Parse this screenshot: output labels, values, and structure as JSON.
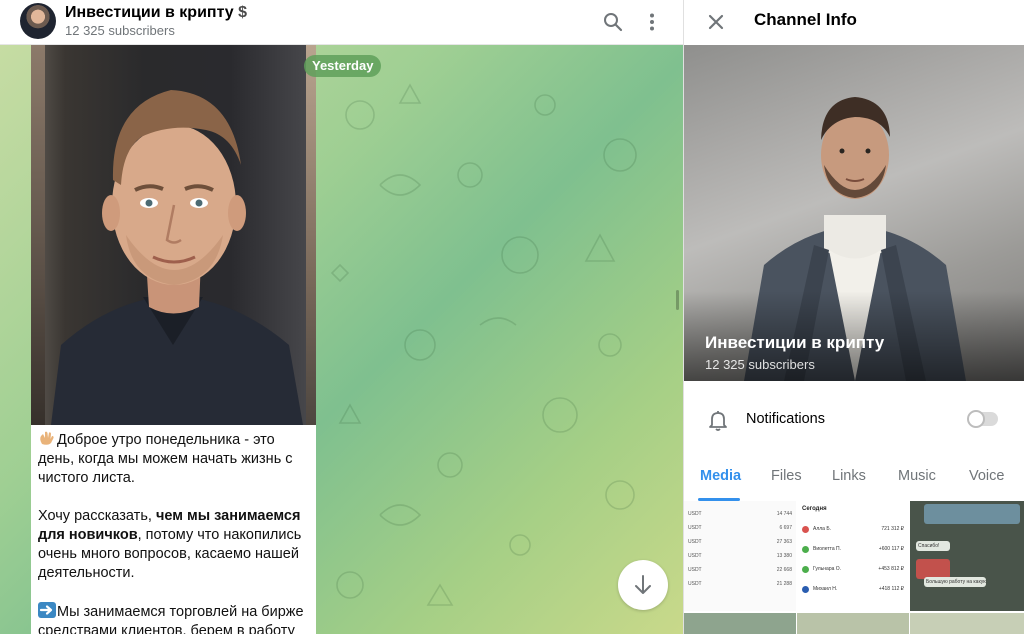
{
  "chat": {
    "title": "Инвестиции в крипту",
    "title_suffix": "$",
    "subtitle": "12 325 subscribers",
    "date_label": "Yesterday",
    "message": {
      "p1_emoji": "waving-hand",
      "p1": "Доброе утро понедельника - это день, когда мы можем начать жизнь с чистого листа.",
      "p2_start": "Хочу рассказать, ",
      "p2_bold": "чем мы занимаемся для новичков",
      "p2_end": ", потому что накопились очень много вопросов, касаемо нашей деятельности.",
      "p3_emoji": "right-arrow",
      "p3": "Мы занимаемся торговлей на бирже средствами клиентов, берем в работу"
    },
    "icons": {
      "search": "search-icon",
      "more": "more-vertical-icon",
      "scroll_down": "arrow-down-icon"
    }
  },
  "info": {
    "title": "Channel Info",
    "channel_name": "Инвестиции в крипту",
    "channel_subs": "12 325 subscribers",
    "notifications_label": "Notifications",
    "notifications_on": false,
    "tabs": [
      "Media",
      "Files",
      "Links",
      "Music",
      "Voice"
    ],
    "active_tab": "Media",
    "media_thumbs": {
      "list_rows": [
        {
          "code": "USDT",
          "amount": "14 744"
        },
        {
          "code": "USDT",
          "amount": "6 697"
        },
        {
          "code": "USDT",
          "amount": "27 363"
        },
        {
          "code": "USDT",
          "amount": "13 380"
        },
        {
          "code": "USDT",
          "amount": "22 668"
        },
        {
          "code": "USDT",
          "amount": "21 288"
        }
      ],
      "transfers_title": "Сегодня",
      "transfers": [
        {
          "name": "Алла Б.",
          "amount": "721 312 ₽"
        },
        {
          "name": "Виолетта П.",
          "amount": "+600 117 ₽"
        },
        {
          "name": "Гульнара О.",
          "amount": "+453 812 ₽"
        },
        {
          "name": "Михаил Н.",
          "amount": "+418 112 ₽"
        }
      ],
      "chat_snippet": [
        "Спасибо!",
        "Большую работу на какую!"
      ]
    }
  },
  "colors": {
    "accent": "#3390ec",
    "date_pill": "#5fa05a",
    "chat_bg": "#9fcf93"
  }
}
